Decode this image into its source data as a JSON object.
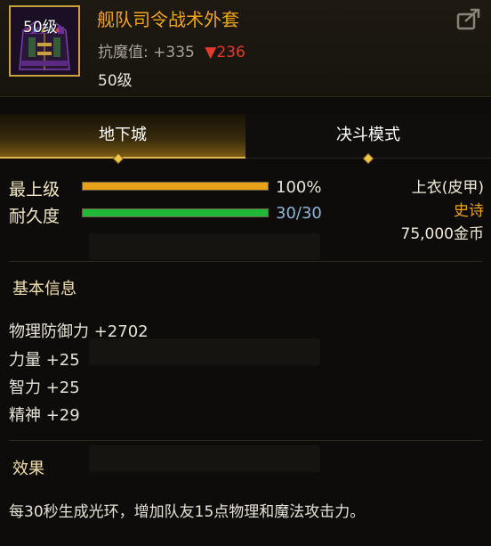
{
  "header": {
    "level_badge": "50级",
    "item_name": "舰队司令战术外套",
    "stat_label": "抗魔值:",
    "stat_value": "+335",
    "stat_change": "▼236",
    "required_level": "50级",
    "icons": {
      "share": "share-icon",
      "item": "coat-icon"
    }
  },
  "tabs": [
    {
      "label": "地下城",
      "active": true
    },
    {
      "label": "决斗模式",
      "active": false
    }
  ],
  "bars": [
    {
      "label": "最上级",
      "value_text": "100%",
      "fraction": 1.0,
      "color": "#e8a21a"
    },
    {
      "label": "耐久度",
      "value_text": "30/30",
      "fraction": 1.0,
      "color": "#22b83a"
    }
  ],
  "item_meta": {
    "slot": "上衣(皮甲)",
    "rarity": "史诗",
    "price": "75,000金币"
  },
  "basic_info": {
    "title": "基本信息",
    "stats": [
      "物理防御力 +2702",
      "力量 +25",
      "智力 +25",
      "精神 +29"
    ]
  },
  "effect": {
    "title": "效果",
    "text": "每30秒生成光环，增加队友15点物理和魔法攻击力。"
  },
  "colors": {
    "accent_gold": "#f0a418",
    "decrease_red": "#e43a2e",
    "durability_value": "#8fb4d8"
  }
}
